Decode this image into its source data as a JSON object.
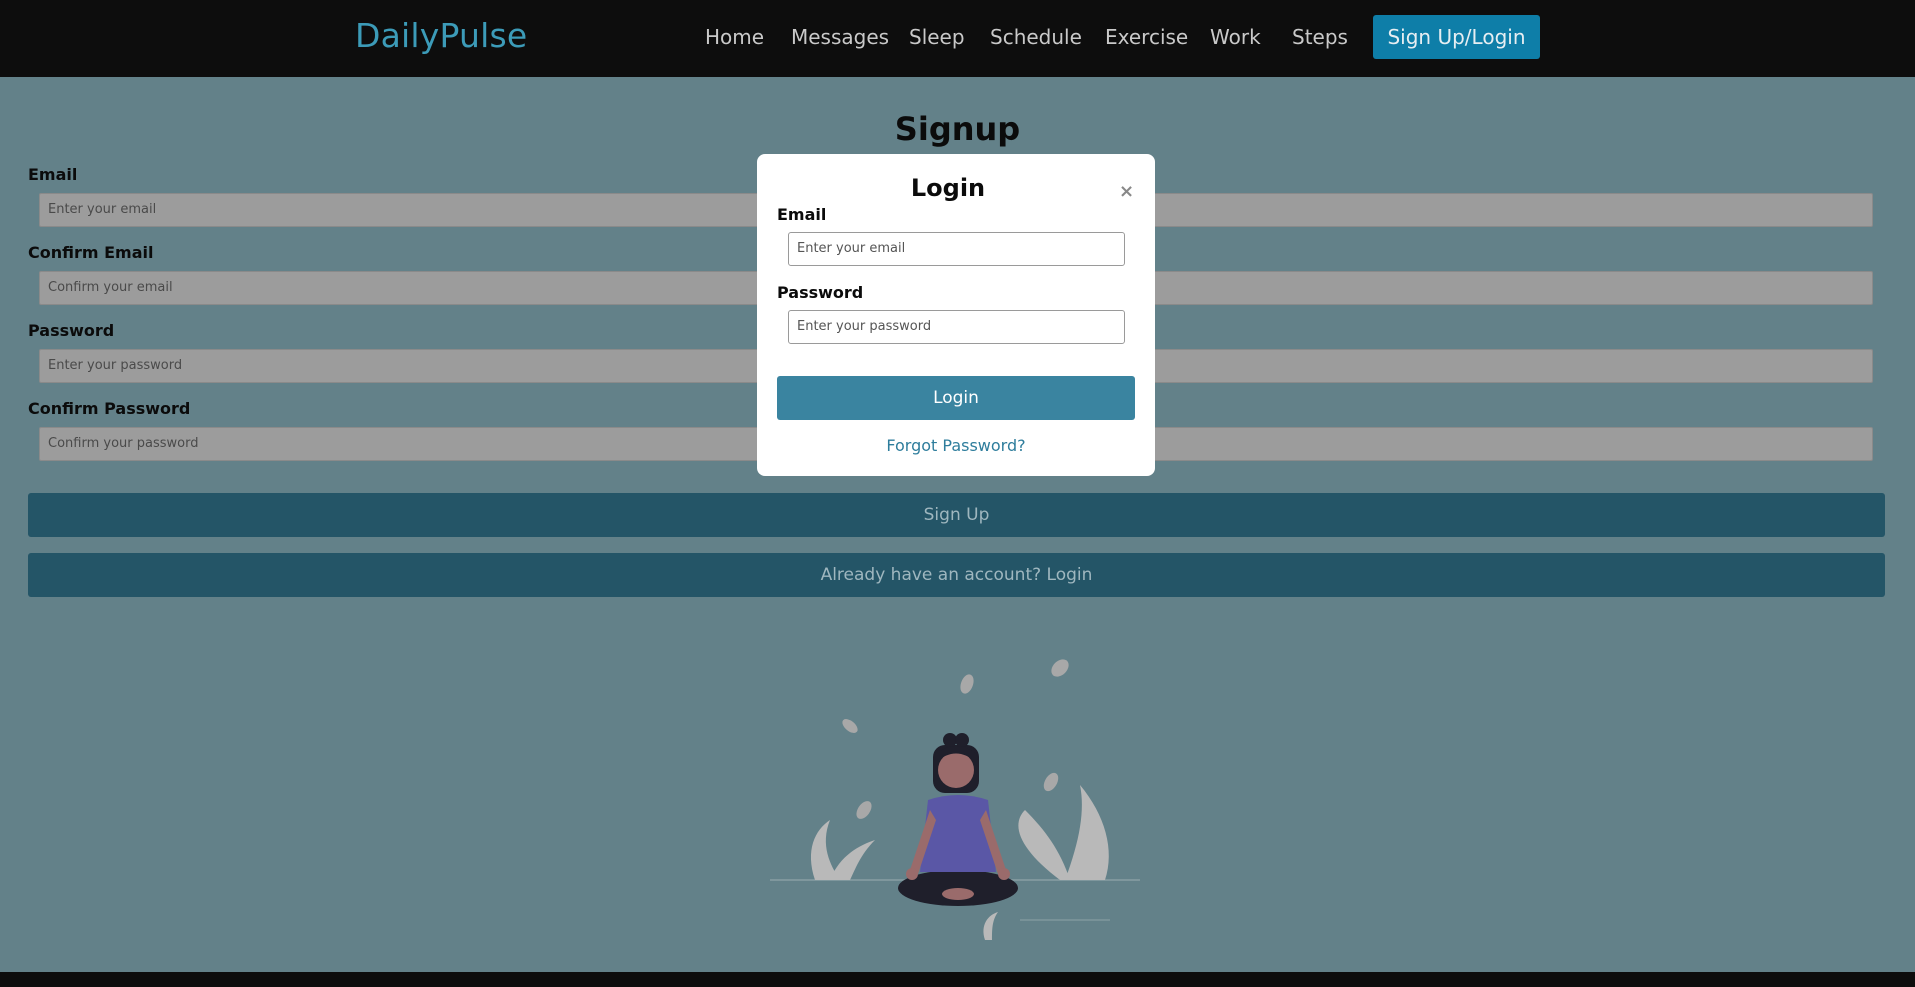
{
  "nav": {
    "brand": "DailyPulse",
    "links": [
      "Home",
      "Messages",
      "Sleep",
      "Schedule",
      "Exercise",
      "Work",
      "Steps"
    ],
    "cta": "Sign Up/Login"
  },
  "signup": {
    "title": "Signup",
    "fields": [
      {
        "label": "Email",
        "placeholder": "Enter your email"
      },
      {
        "label": "Confirm Email",
        "placeholder": "Confirm your email"
      },
      {
        "label": "Password",
        "placeholder": "Enter your password"
      },
      {
        "label": "Confirm Password",
        "placeholder": "Confirm your password"
      }
    ],
    "signup_button": "Sign Up",
    "login_link_button": "Already have an account? Login"
  },
  "modal": {
    "title": "Login",
    "close_icon": "×",
    "email_label": "Email",
    "email_placeholder": "Enter your email",
    "password_label": "Password",
    "password_placeholder": "Enter your password",
    "login_button": "Login",
    "forgot_link": "Forgot Password?"
  },
  "colors": {
    "brand": "#3c9bb8",
    "cta": "#0e7ea8",
    "overlay_bg": "#638189",
    "button_dark": "#245567",
    "modal_button": "#3a84a0"
  }
}
